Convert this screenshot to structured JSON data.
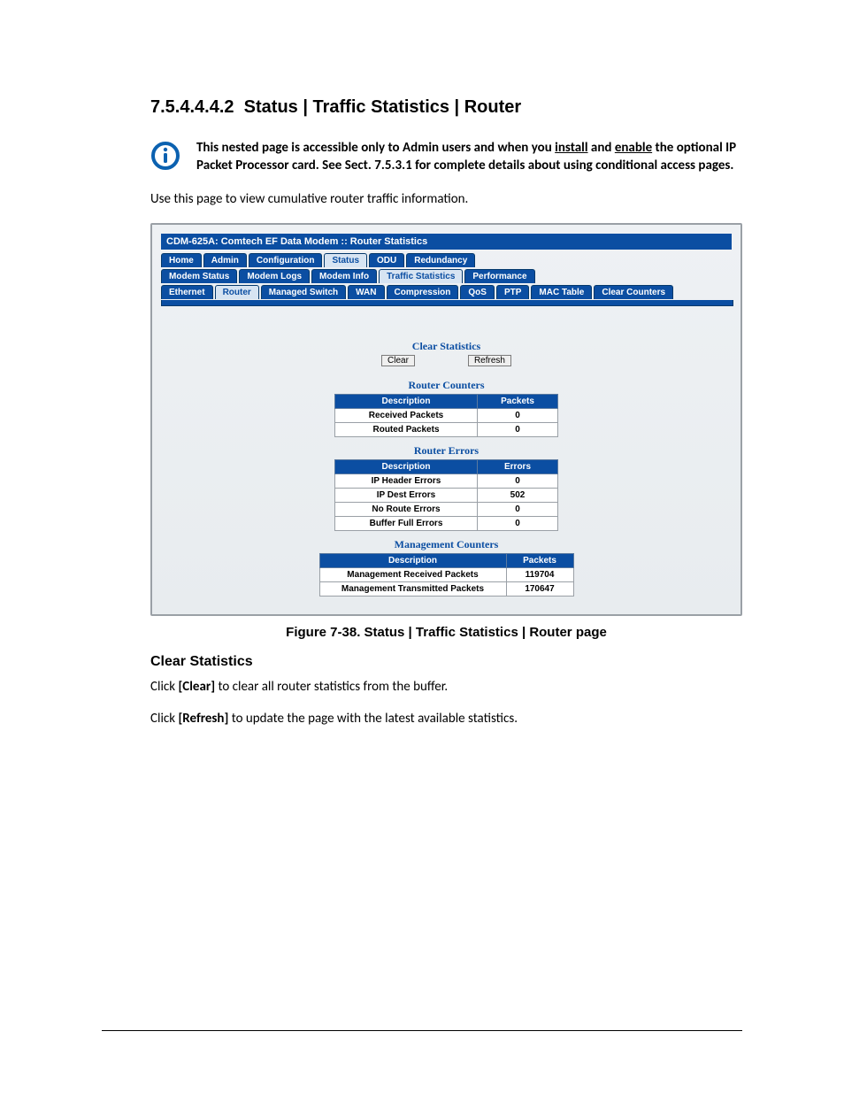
{
  "heading_number": "7.5.4.4.4.2",
  "heading_title": "Status | Traffic Statistics | Router",
  "note": {
    "p1a": "This nested page is accessible only to Admin users and when you ",
    "install": "install",
    "p1b": " and ",
    "enable": "enable",
    "p1c": " the optional IP Packet Processor card. See Sect. 7.5.3.1 for complete details about using conditional access pages."
  },
  "intro": "Use this page to view cumulative router traffic information.",
  "shot": {
    "title": "CDM-625A: Comtech EF Data Modem :: Router Statistics",
    "tabs_row1": [
      {
        "label": "Home",
        "on": true
      },
      {
        "label": "Admin",
        "on": true
      },
      {
        "label": "Configuration",
        "on": true
      },
      {
        "label": "Status",
        "on": false
      },
      {
        "label": "ODU",
        "on": true
      },
      {
        "label": "Redundancy",
        "on": true
      }
    ],
    "tabs_row2": [
      {
        "label": "Modem Status",
        "on": true
      },
      {
        "label": "Modem Logs",
        "on": true
      },
      {
        "label": "Modem Info",
        "on": true
      },
      {
        "label": "Traffic Statistics",
        "on": false
      },
      {
        "label": "Performance",
        "on": true
      }
    ],
    "tabs_row3": [
      {
        "label": "Ethernet",
        "on": true
      },
      {
        "label": "Router",
        "on": false
      },
      {
        "label": "Managed Switch",
        "on": true
      },
      {
        "label": "WAN",
        "on": true
      },
      {
        "label": "Compression",
        "on": true
      },
      {
        "label": "QoS",
        "on": true
      },
      {
        "label": "PTP",
        "on": true
      },
      {
        "label": "MAC Table",
        "on": true
      },
      {
        "label": "Clear Counters",
        "on": true
      }
    ],
    "clear_stats_title": "Clear Statistics",
    "clear_btn": "Clear",
    "refresh_btn": "Refresh",
    "router_counters": {
      "title": "Router Counters",
      "h1": "Description",
      "h2": "Packets",
      "rows": [
        [
          "Received Packets",
          "0"
        ],
        [
          "Routed Packets",
          "0"
        ]
      ]
    },
    "router_errors": {
      "title": "Router Errors",
      "h1": "Description",
      "h2": "Errors",
      "rows": [
        [
          "IP Header Errors",
          "0"
        ],
        [
          "IP Dest Errors",
          "502"
        ],
        [
          "No Route Errors",
          "0"
        ],
        [
          "Buffer Full Errors",
          "0"
        ]
      ]
    },
    "mgmt": {
      "title": "Management Counters",
      "h1": "Description",
      "h2": "Packets",
      "rows": [
        [
          "Management Received Packets",
          "119704"
        ],
        [
          "Management Transmitted Packets",
          "170647"
        ]
      ]
    }
  },
  "figure_caption": "Figure 7-38. Status | Traffic Statistics | Router page",
  "clear_heading": "Clear Statistics",
  "clear_p1a": "Click ",
  "clear_p1b": "[Clear]",
  "clear_p1c": " to clear all router statistics from the buffer.",
  "clear_p2a": "Click ",
  "clear_p2b": "[Refresh]",
  "clear_p2c": " to update the page with the latest available statistics."
}
